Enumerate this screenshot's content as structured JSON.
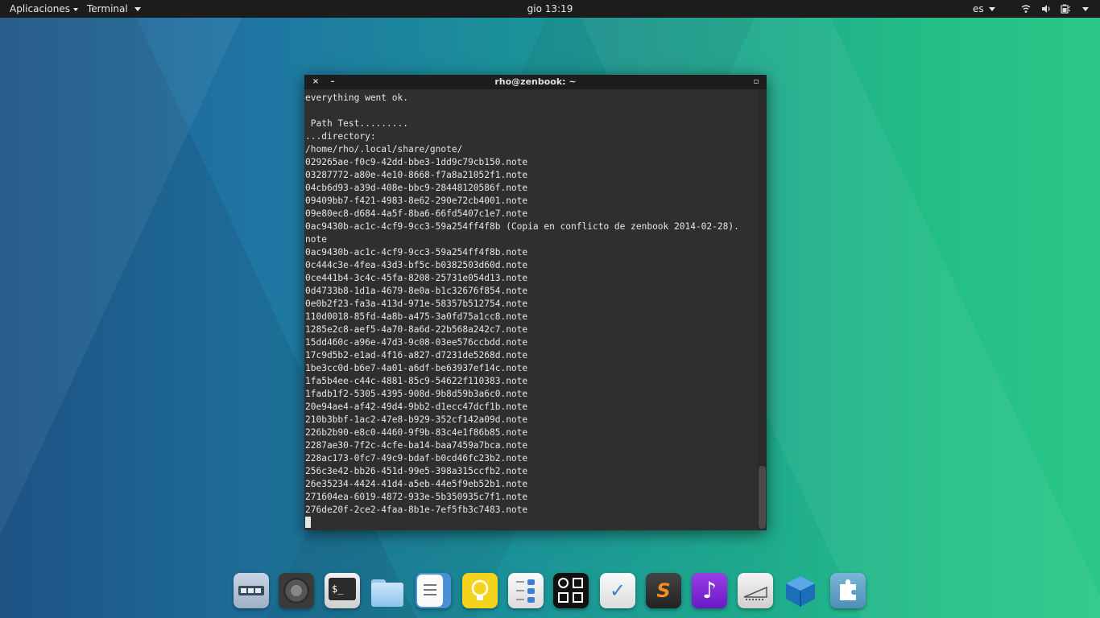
{
  "topbar": {
    "apps_menu": "Aplicaciones",
    "terminal_menu": "Terminal",
    "clock": "gio 13:19",
    "keyboard_layout": "es"
  },
  "window": {
    "title": "rho@zenbook: ~",
    "close_glyph": "×",
    "minimize_glyph": "–",
    "maximize_glyph": "▫"
  },
  "terminal": {
    "lines": [
      "everything went ok.",
      "",
      " Path Test.........",
      "...directory:",
      "/home/rho/.local/share/gnote/",
      "029265ae-f0c9-42dd-bbe3-1dd9c79cb150.note",
      "03287772-a80e-4e10-8668-f7a8a21052f1.note",
      "04cb6d93-a39d-408e-bbc9-28448120586f.note",
      "09409bb7-f421-4983-8e62-290e72cb4001.note",
      "09e80ec8-d684-4a5f-8ba6-66fd5407c1e7.note",
      "0ac9430b-ac1c-4cf9-9cc3-59a254ff4f8b (Copia en conflicto de zenbook 2014-02-28).",
      "note",
      "0ac9430b-ac1c-4cf9-9cc3-59a254ff4f8b.note",
      "0c444c3e-4fea-43d3-bf5c-b0382503d60d.note",
      "0ce441b4-3c4c-45fa-8208-25731e054d13.note",
      "0d4733b8-1d1a-4679-8e0a-b1c32676f854.note",
      "0e0b2f23-fa3a-413d-971e-58357b512754.note",
      "110d0018-85fd-4a8b-a475-3a0fd75a1cc8.note",
      "1285e2c8-aef5-4a70-8a6d-22b568a242c7.note",
      "15dd460c-a96e-47d3-9c08-03ee576ccbdd.note",
      "17c9d5b2-e1ad-4f16-a827-d7231de5268d.note",
      "1be3cc0d-b6e7-4a01-a6df-be63937ef14c.note",
      "1fa5b4ee-c44c-4881-85c9-54622f110383.note",
      "1fadb1f2-5305-4395-908d-9b8d59b3a6c0.note",
      "20e94ae4-af42-49d4-9bb2-d1ecc47dcf1b.note",
      "210b3bbf-1ac2-47e8-b929-352cf142a09d.note",
      "226b2b90-e8c0-4460-9f9b-83c4e1f86b85.note",
      "2287ae30-7f2c-4cfe-ba14-baa7459a7bca.note",
      "228ac173-0fc7-49c9-bdaf-b0cd46fc23b2.note",
      "256c3e42-bb26-451d-99e5-398a315ccfb2.note",
      "26e35234-4424-41d4-a5eb-44e5f9eb52b1.note",
      "271604ea-6019-4872-933e-5b350935c7f1.note",
      "276de20f-2ce2-4faa-8b1e-7ef5fb3c7483.note"
    ]
  },
  "dock": {
    "icons": [
      "workspaces-icon",
      "screenshot-icon",
      "terminal-icon",
      "files-icon",
      "text-editor-icon",
      "ideas-icon",
      "tweak-settings-icon",
      "backup-icon",
      "tasks-icon",
      "sublime-text-icon",
      "music-icon",
      "disk-usage-icon",
      "virtualbox-icon",
      "extensions-icon"
    ],
    "terminal_glyph": "$_",
    "music_glyph": "♪",
    "tasks_glyph": "✓",
    "sublime_glyph": "S"
  },
  "colors": {
    "panel": "#1c1c1c",
    "terminal_bg": "#2f2f2f",
    "terminal_fg": "#e6e6e6"
  }
}
